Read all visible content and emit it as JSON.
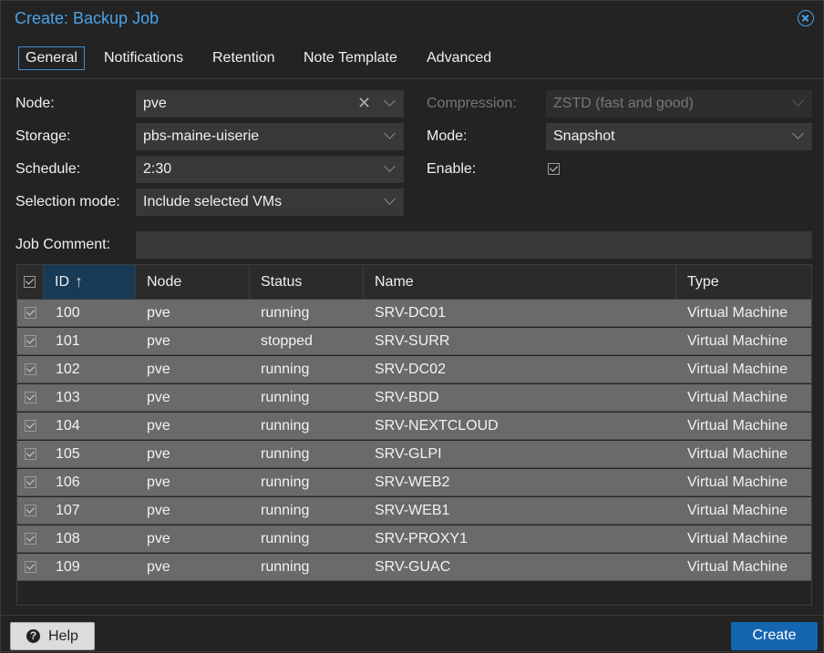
{
  "dialog": {
    "title": "Create: Backup Job"
  },
  "tabs": [
    {
      "label": "General",
      "active": true
    },
    {
      "label": "Notifications"
    },
    {
      "label": "Retention"
    },
    {
      "label": "Note Template"
    },
    {
      "label": "Advanced"
    }
  ],
  "form": {
    "node": {
      "label": "Node:",
      "value": "pve"
    },
    "storage": {
      "label": "Storage:",
      "value": "pbs-maine-uiserie"
    },
    "schedule": {
      "label": "Schedule:",
      "value": "2:30"
    },
    "selection_mode": {
      "label": "Selection mode:",
      "value": "Include selected VMs"
    },
    "compression": {
      "label": "Compression:",
      "value": "ZSTD (fast and good)",
      "disabled": true
    },
    "mode": {
      "label": "Mode:",
      "value": "Snapshot"
    },
    "enable": {
      "label": "Enable:",
      "checked": true
    },
    "job_comment": {
      "label": "Job Comment:",
      "value": ""
    }
  },
  "grid": {
    "columns": {
      "id": "ID",
      "node": "Node",
      "status": "Status",
      "name": "Name",
      "type": "Type"
    },
    "sort_indicator": "↑",
    "rows": [
      {
        "id": "100",
        "node": "pve",
        "status": "running",
        "name": "SRV-DC01",
        "type": "Virtual Machine"
      },
      {
        "id": "101",
        "node": "pve",
        "status": "stopped",
        "name": "SRV-SURR",
        "type": "Virtual Machine"
      },
      {
        "id": "102",
        "node": "pve",
        "status": "running",
        "name": "SRV-DC02",
        "type": "Virtual Machine"
      },
      {
        "id": "103",
        "node": "pve",
        "status": "running",
        "name": "SRV-BDD",
        "type": "Virtual Machine"
      },
      {
        "id": "104",
        "node": "pve",
        "status": "running",
        "name": "SRV-NEXTCLOUD",
        "type": "Virtual Machine"
      },
      {
        "id": "105",
        "node": "pve",
        "status": "running",
        "name": "SRV-GLPI",
        "type": "Virtual Machine"
      },
      {
        "id": "106",
        "node": "pve",
        "status": "running",
        "name": "SRV-WEB2",
        "type": "Virtual Machine"
      },
      {
        "id": "107",
        "node": "pve",
        "status": "running",
        "name": "SRV-WEB1",
        "type": "Virtual Machine"
      },
      {
        "id": "108",
        "node": "pve",
        "status": "running",
        "name": "SRV-PROXY1",
        "type": "Virtual Machine"
      },
      {
        "id": "109",
        "node": "pve",
        "status": "running",
        "name": "SRV-GUAC",
        "type": "Virtual Machine"
      }
    ]
  },
  "footer": {
    "help_label": "Help",
    "help_icon": "?",
    "create_label": "Create"
  },
  "colors": {
    "accent": "#4aa3e8",
    "primary_button": "#1566b0",
    "selected_row": "#6a6a6a",
    "sorted_header": "#173a56"
  }
}
